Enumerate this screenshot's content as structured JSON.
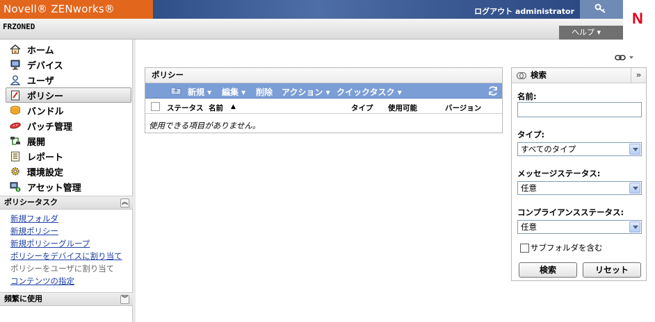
{
  "header": {
    "brand": "Novell® ZENworks®",
    "logout_label": "ログアウト administrator",
    "logo_letter": "N",
    "zone_name": "FRZONED",
    "help_label": "ヘルプ ▾"
  },
  "nav": {
    "items": [
      {
        "label": "ホーム",
        "icon": "home-icon"
      },
      {
        "label": "デバイス",
        "icon": "monitor-icon"
      },
      {
        "label": "ユーザ",
        "icon": "user-icon"
      },
      {
        "label": "ポリシー",
        "icon": "policy-icon"
      },
      {
        "label": "バンドル",
        "icon": "bundle-icon"
      },
      {
        "label": "パッチ管理",
        "icon": "patch-icon"
      },
      {
        "label": "展開",
        "icon": "deploy-icon"
      },
      {
        "label": "レポート",
        "icon": "report-icon"
      },
      {
        "label": "環境設定",
        "icon": "config-icon"
      },
      {
        "label": "アセット管理",
        "icon": "asset-icon"
      }
    ],
    "active_index": 3
  },
  "policy_tasks": {
    "title": "ポリシータスク",
    "links": [
      {
        "label": "新規フォルダ",
        "enabled": true
      },
      {
        "label": "新規ポリシー",
        "enabled": true
      },
      {
        "label": "新規ポリシーグループ",
        "enabled": true
      },
      {
        "label": "ポリシーをデバイスに割り当て",
        "enabled": true
      },
      {
        "label": "ポリシーをユーザに割り当て",
        "enabled": false
      },
      {
        "label": "コンテンツの指定",
        "enabled": true
      }
    ]
  },
  "frequent": {
    "title": "頻繁に使用"
  },
  "policy_panel": {
    "title": "ポリシー",
    "toolbar": {
      "new": "新規 ▾",
      "edit": "編集 ▾",
      "delete": "削除",
      "action": "アクション ▾",
      "quick_task": "クイックタスク ▾"
    },
    "columns": [
      "ステータス",
      "名前",
      "タイプ",
      "使用可能",
      "バージョン"
    ],
    "sort_indicator": "▲",
    "empty_message": "使用できる項目がありません。"
  },
  "search_panel": {
    "title": "検索",
    "expand": "»",
    "name_label": "名前:",
    "name_value": "",
    "type_label": "タイプ:",
    "type_value": "すべてのタイプ",
    "message_status_label": "メッセージステータス:",
    "message_status_value": "任意",
    "compliance_label": "コンプライアンスステータス:",
    "compliance_value": "任意",
    "subfolder_label": "サブフォルダを含む",
    "subfolder_checked": false,
    "search_button": "検索",
    "reset_button": "リセット"
  },
  "colors": {
    "brand_orange": "#e2661c",
    "banner_blue": "#3c5a93",
    "toolbar_blue": "#7b9ed6",
    "link_blue": "#1c3ea5",
    "logo_red": "#e2001a"
  }
}
